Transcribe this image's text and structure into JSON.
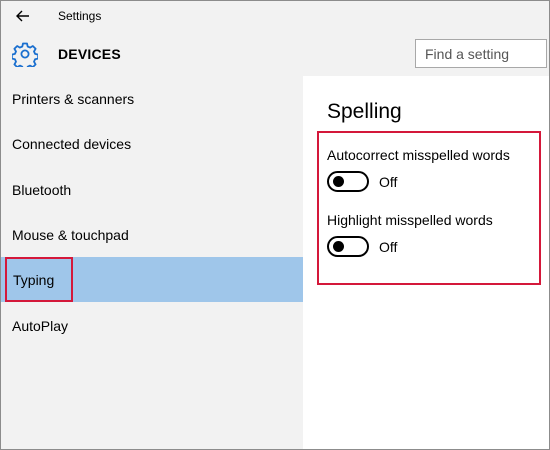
{
  "titlebar": {
    "title": "Settings"
  },
  "header": {
    "title": "DEVICES"
  },
  "search": {
    "placeholder": "Find a setting"
  },
  "sidebar": {
    "items": [
      {
        "label": "Printers & scanners",
        "active": false
      },
      {
        "label": "Connected devices",
        "active": false
      },
      {
        "label": "Bluetooth",
        "active": false
      },
      {
        "label": "Mouse & touchpad",
        "active": false
      },
      {
        "label": "Typing",
        "active": true
      },
      {
        "label": "AutoPlay",
        "active": false
      }
    ]
  },
  "main": {
    "section_title": "Spelling",
    "settings": [
      {
        "label": "Autocorrect misspelled words",
        "state": "Off"
      },
      {
        "label": "Highlight misspelled words",
        "state": "Off"
      }
    ]
  },
  "colors": {
    "active_item": "#9fc6ea",
    "highlight_border": "#d4183a",
    "chrome_bg": "#f2f2f2",
    "gear_icon": "#1a6fcf"
  }
}
